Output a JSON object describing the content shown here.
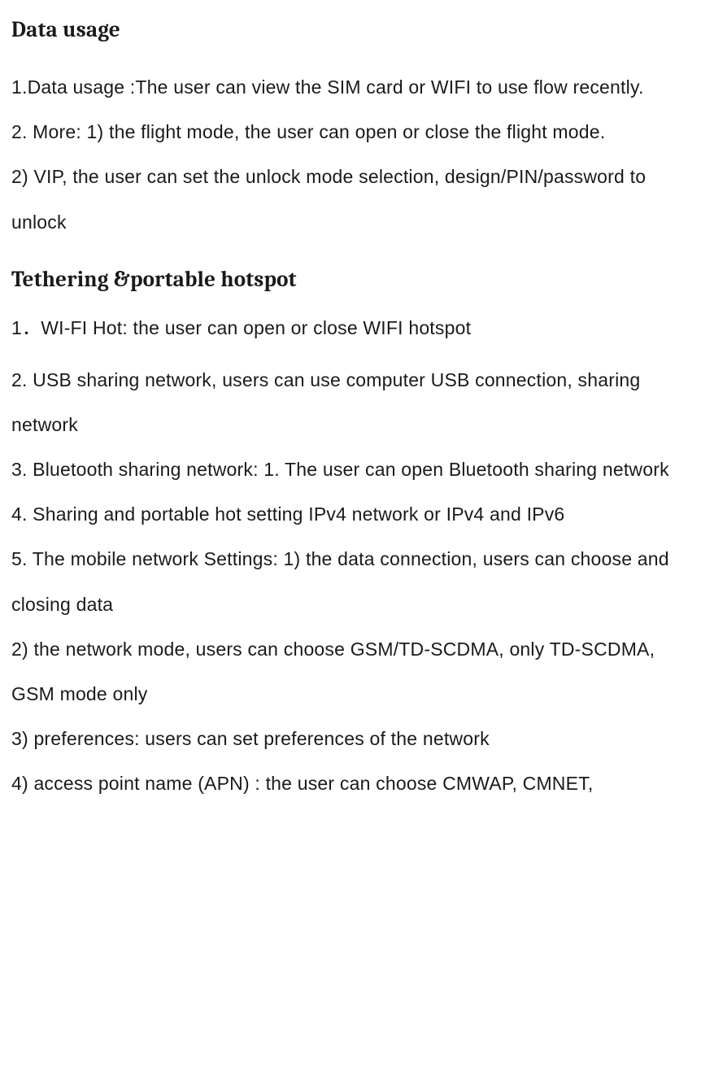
{
  "sections": {
    "data_usage": {
      "heading": "Data usage",
      "p1": "1.Data usage :The user can view the SIM card or WIFI to use flow recently.",
      "p2": "2. More: 1) the flight mode, the user can open or close the flight mode.",
      "p3": "2) VIP, the user can set the unlock mode selection, design/PIN/password to unlock"
    },
    "tethering": {
      "heading": "Tethering &portable hotspot",
      "p1": "1．WI-FI Hot: the user can open or close WIFI hotspot",
      "p2": "2. USB sharing network, users can use computer USB connection, sharing network",
      "p3": "3. Bluetooth sharing network: 1. The user can open Bluetooth sharing network",
      "p4": "4. Sharing and portable hot setting IPv4 network or IPv4 and IPv6",
      "p5": "5. The mobile network Settings: 1) the data connection, users can choose and closing data",
      "p6": "2) the network mode, users can choose GSM/TD-SCDMA, only TD-SCDMA, GSM mode only",
      "p7": "3) preferences: users can set preferences of the network",
      "p8": "4) access point name (APN) : the user can choose CMWAP, CMNET,"
    }
  }
}
